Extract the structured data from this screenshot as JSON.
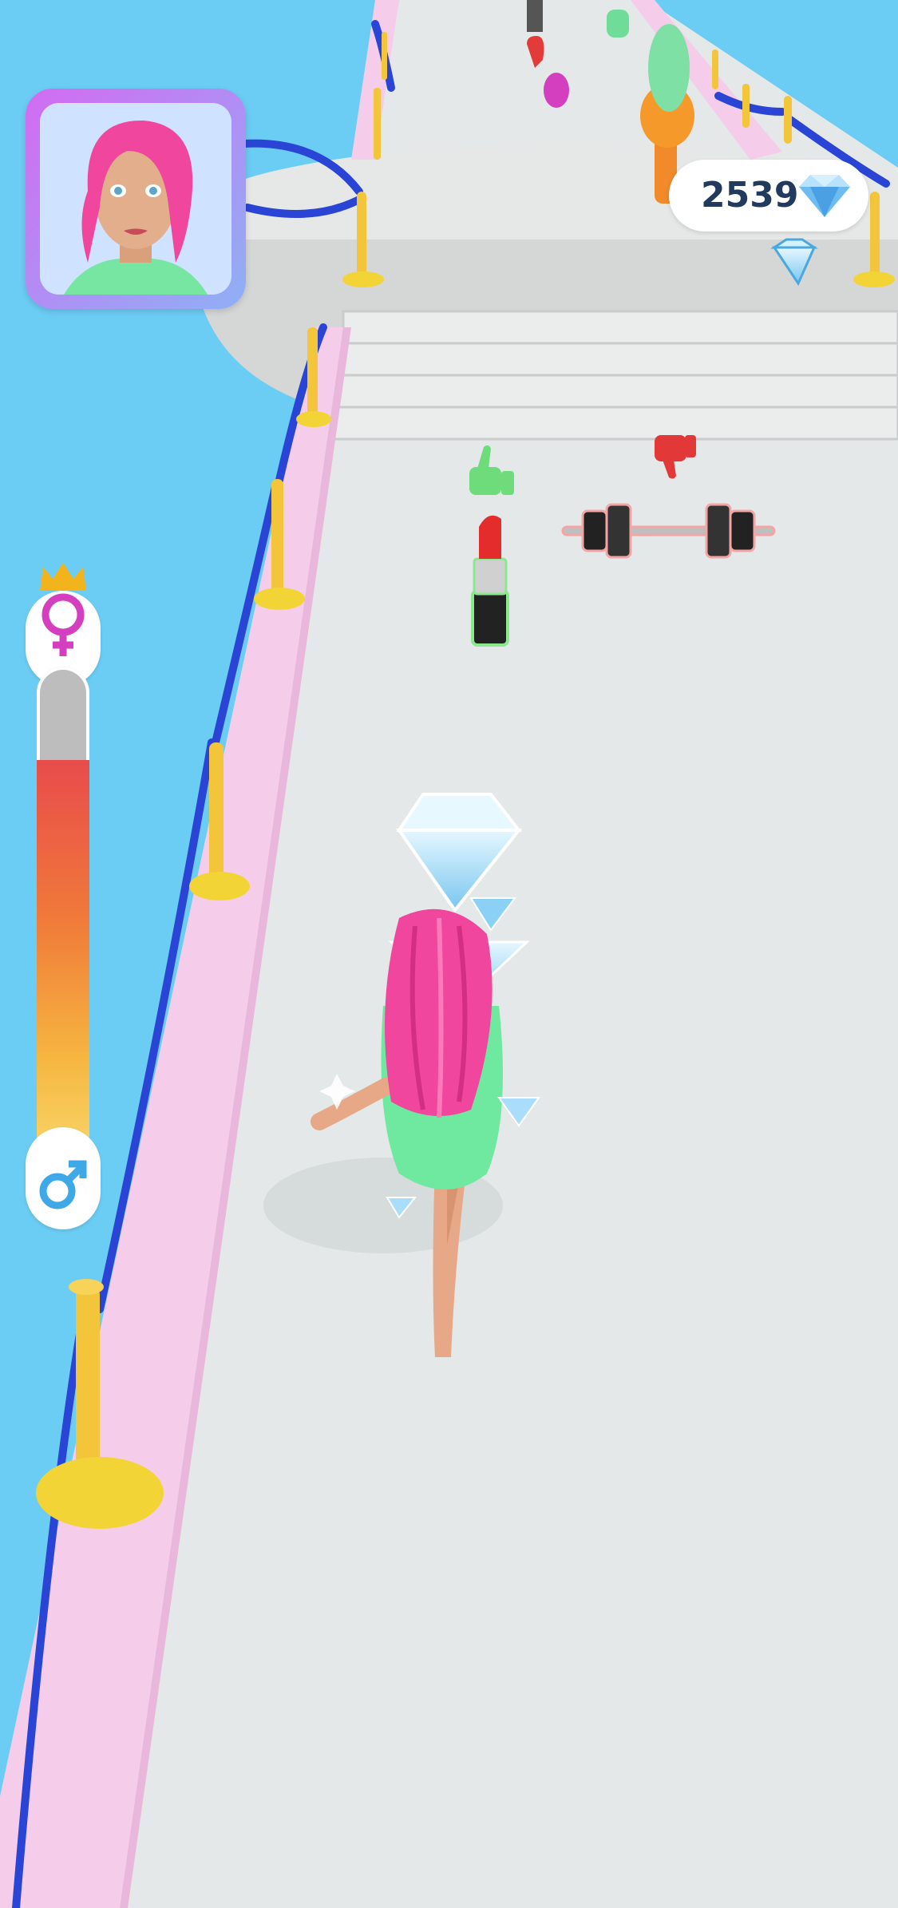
{
  "hud": {
    "gem_count": "2539",
    "gem_icon": "diamond-icon",
    "portrait": "character-portrait",
    "meter": {
      "top_icon": "female-crown-icon",
      "bottom_icon": "male-icon",
      "fill_fraction": 0.81
    }
  },
  "track": {
    "items": [
      {
        "type": "lipstick",
        "rating": "thumbs-up"
      },
      {
        "type": "barbell",
        "rating": "thumbs-down"
      },
      {
        "type": "diamond-stack"
      }
    ]
  },
  "colors": {
    "sky": "#6ccdf4",
    "runway": "#e5e9e9",
    "rope": "#2a45d6",
    "rail": "#f5cdeb",
    "fill_top": "#e84b4b",
    "fill_bottom": "#f8d76b",
    "hair": "#f0469e",
    "dress": "#6fe8a0"
  }
}
